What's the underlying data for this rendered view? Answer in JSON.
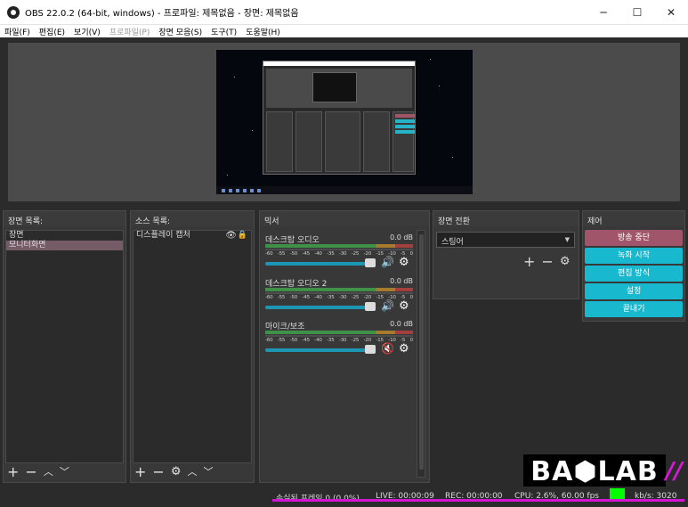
{
  "window": {
    "title": "OBS 22.0.2 (64-bit, windows) - 프로파일: 제목없음 - 장면: 제목없음",
    "minimize": "─",
    "maximize": "☐",
    "close": "✕"
  },
  "menu": [
    "파일(F)",
    "편집(E)",
    "보기(V)",
    "프로파일(P)",
    "장면 모음(S)",
    "도구(T)",
    "도움말(H)"
  ],
  "scenes": {
    "header": "장면 목록:",
    "items": [
      "장면",
      "모니터화면"
    ],
    "selected": "모니터화면"
  },
  "sources": {
    "header": "소스 목록:",
    "items": [
      "디스플레이 캡처"
    ]
  },
  "mixer": {
    "header": "믹서",
    "channels": [
      {
        "name": "데스크탑 오디오",
        "db": "0.0 dB",
        "muted": false,
        "volume": 0.92
      },
      {
        "name": "데스크탑 오디오 2",
        "db": "0.0 dB",
        "muted": false,
        "volume": 0.92
      },
      {
        "name": "마이크/보조",
        "db": "0.0 dB",
        "muted": true,
        "volume": 0.92
      }
    ],
    "scale": [
      "-60",
      "-55",
      "-50",
      "-45",
      "-40",
      "-35",
      "-30",
      "-25",
      "-20",
      "-15",
      "-10",
      "-5",
      "0"
    ]
  },
  "transition": {
    "header": "장면 전환",
    "selected": "스팅어"
  },
  "controls": {
    "header": "제어",
    "stop_stream": "방송 중단",
    "start_record": "녹화 시작",
    "studio_mode": "편집 방식",
    "settings": "설정",
    "exit": "끝내기"
  },
  "toolbar": {
    "add": "+",
    "remove": "−",
    "up": "︿",
    "down": "﹀",
    "gear": "⚙"
  },
  "status": {
    "dropped": "손실된 프레임 0 (0.0%)",
    "live": "LIVE: 00:00:09",
    "rec": "REC: 00:00:00",
    "cpu": "CPU: 2.6%, 60.00 fps",
    "kbps": "kb/s: 3020"
  },
  "watermark": {
    "text": "BA⬢LAB",
    "slashes": "//"
  },
  "colors": {
    "accent_cyan": "#18b8cf",
    "stop_red": "#a0556a",
    "selected_row": "#745b65",
    "status_green": "#00ff00",
    "overlay_magenta": "#d414d4"
  }
}
